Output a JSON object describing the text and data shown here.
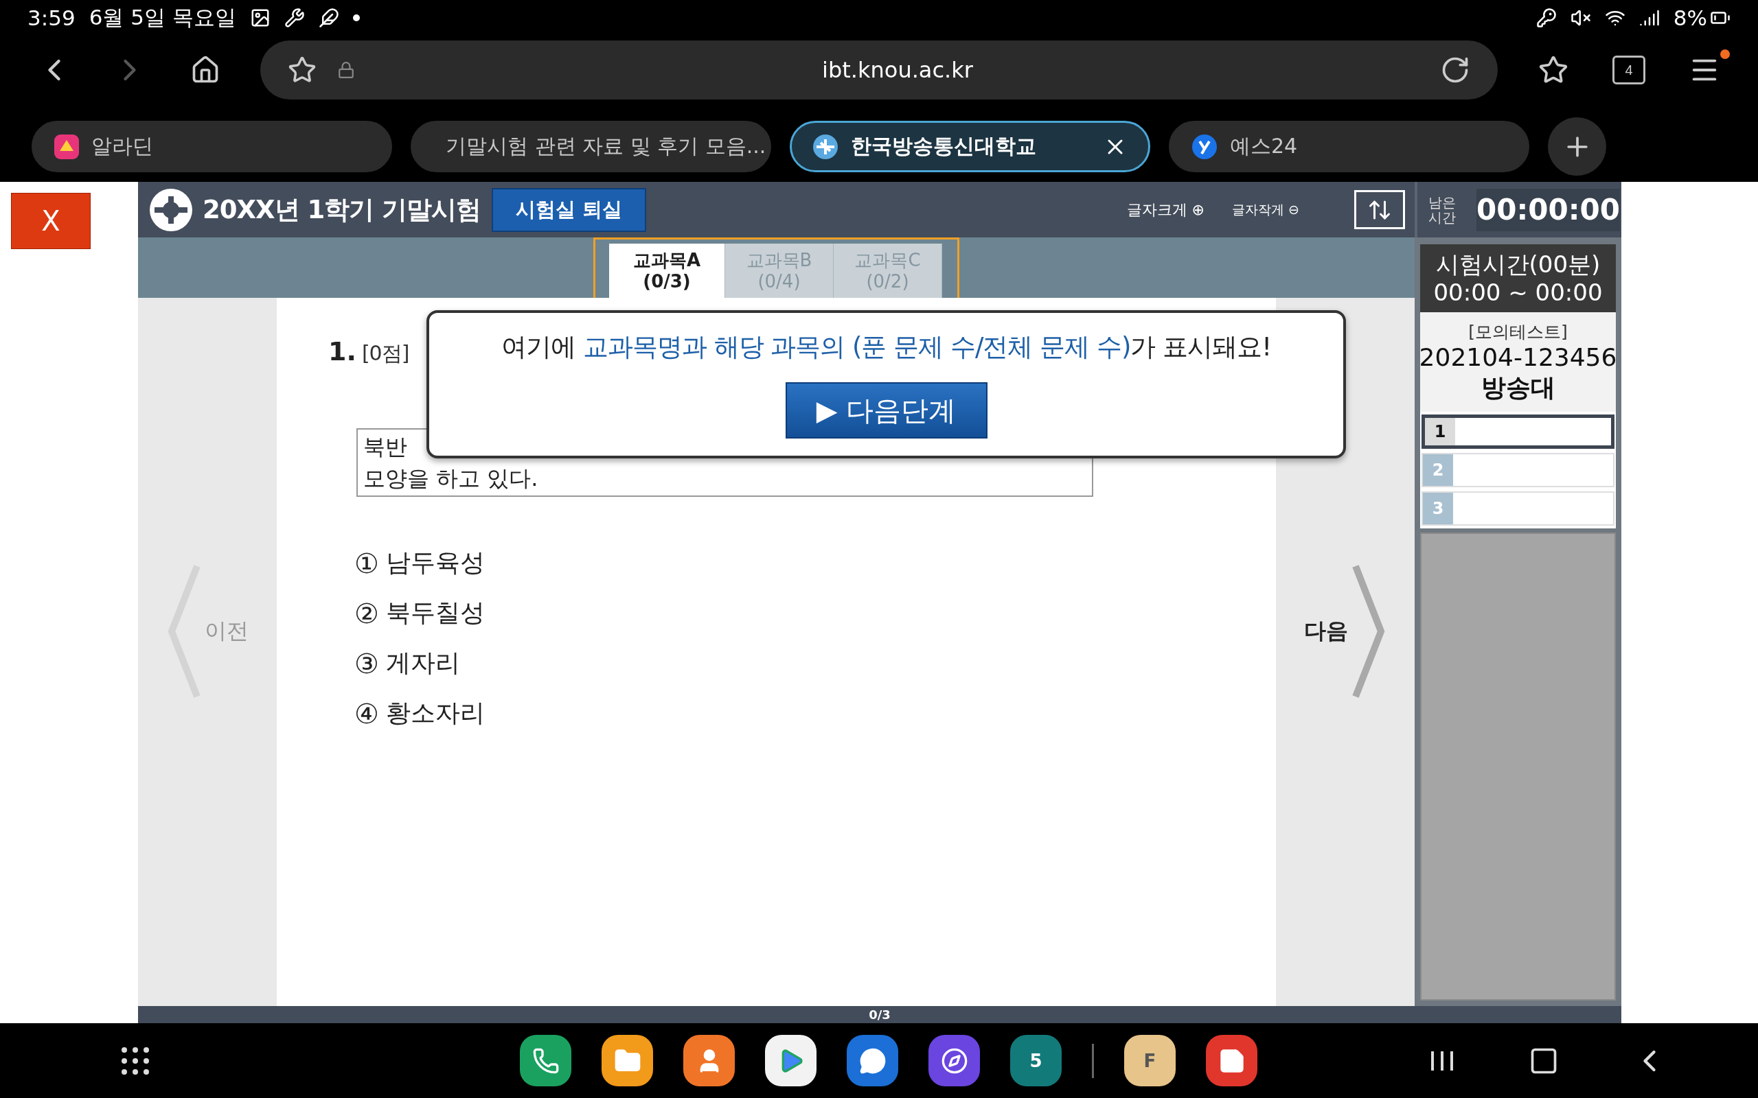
{
  "status_bar": {
    "time": "3:59",
    "date": "6월 5일 목요일",
    "battery": "8%"
  },
  "browser": {
    "url": "ibt.knou.ac.kr",
    "tab_count": "4",
    "tabs": [
      {
        "title": "알라딘",
        "kind": "aladin",
        "selected": false
      },
      {
        "title": "기말시험 관련 자료 및 후기 모음...",
        "kind": "pin",
        "selected": false
      },
      {
        "title": "한국방송통신대학교",
        "kind": "knou",
        "selected": true
      },
      {
        "title": "예스24",
        "kind": "yes24",
        "selected": false
      }
    ]
  },
  "close_button": "X",
  "exam": {
    "title": "20XX년 1학기 기말시험",
    "exit_button": "시험실 퇴실",
    "font_larger": "글자크게 ⊕",
    "font_smaller": "글자작게 ⊖",
    "remaining_label": "남은 시간",
    "timer": "00:00:00",
    "subjects": [
      {
        "name": "교과목A",
        "count": "(0/3)",
        "selected": true
      },
      {
        "name": "교과목B",
        "count": "(0/4)",
        "selected": false
      },
      {
        "name": "교과목C",
        "count": "(0/2)",
        "selected": false
      }
    ],
    "question": {
      "number": "1.",
      "points": "[0점]",
      "passage": [
        "북반",
        "모양을 하고 있다."
      ],
      "options": [
        {
          "marker": "①",
          "text": "남두육성"
        },
        {
          "marker": "②",
          "text": "북두칠성"
        },
        {
          "marker": "③",
          "text": "게자리"
        },
        {
          "marker": "④",
          "text": "황소자리"
        }
      ]
    },
    "prev": "이전",
    "next": "다음",
    "sidebar": {
      "exam_time": "시험시간(00분)",
      "time_range": "00:00 ~ 00:00",
      "test_label": "[모의테스트]",
      "student_id": "202104-123456",
      "name": "방송대",
      "questions": [
        {
          "number": "1",
          "selected": true
        },
        {
          "number": "2",
          "selected": false
        },
        {
          "number": "3",
          "selected": false
        }
      ]
    },
    "progress": "0/3"
  },
  "popup": {
    "message": [
      {
        "text": "여기에 ",
        "highlight": false
      },
      {
        "text": "교과목명과 해당 과목의 (푼 문제 수/전체 문제 수)",
        "highlight": true
      },
      {
        "text": "가 표시돼요!",
        "highlight": false
      }
    ],
    "button": "▶ 다음단계"
  },
  "dock": {
    "apps": [
      {
        "kind": "phone"
      },
      {
        "kind": "folder"
      },
      {
        "kind": "contacts"
      },
      {
        "kind": "store"
      },
      {
        "kind": "messages"
      },
      {
        "kind": "internet"
      },
      {
        "kind": "calendar",
        "label": "5"
      },
      {
        "kind": "separator"
      },
      {
        "kind": "files",
        "label": "F"
      },
      {
        "kind": "notes"
      }
    ]
  }
}
